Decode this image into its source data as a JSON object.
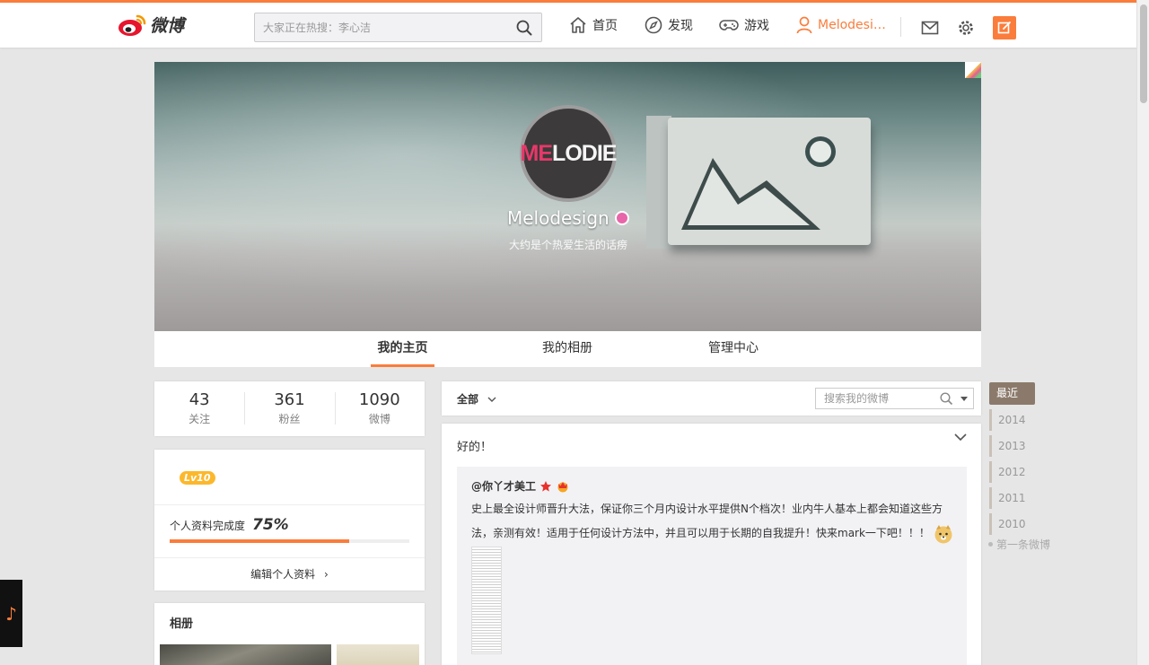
{
  "header": {
    "logo_text": "微博",
    "search_placeholder": "大家正在热搜：李心洁",
    "nav": {
      "home": "首页",
      "discover": "发现",
      "games": "游戏",
      "user": "Melodesi…"
    }
  },
  "cover": {
    "avatar_text_accent": "ME",
    "avatar_text_rest": "LODIE",
    "username": "Melodesign",
    "bio": "大约是个热爱生活的话痨"
  },
  "profile_tabs": [
    "我的主页",
    "我的相册",
    "管理中心"
  ],
  "stats": [
    {
      "num": "43",
      "label": "关注"
    },
    {
      "num": "361",
      "label": "粉丝"
    },
    {
      "num": "1090",
      "label": "微博"
    }
  ],
  "profile_card": {
    "level": "Lv10",
    "completion_label": "个人资料完成度",
    "completion_value": "75%",
    "completion_fraction": 0.75,
    "edit_label": "编辑个人资料"
  },
  "album": {
    "title": "相册"
  },
  "feed": {
    "filter_label": "全部",
    "search_placeholder": "搜索我的微博",
    "post": {
      "text": "好的！",
      "repost_user": "@你丫才美工",
      "repost_line1": "史上最全设计师晋升大法，保证你三个月内设计水平提供N个档次！业内牛人基本上都会知道这些方",
      "repost_line2": "法，亲测有效！适用于任何设计方法中，并且可以用于长期的自我提升！快来mark一下吧！！！"
    }
  },
  "timeline": {
    "recent": "最近",
    "years": [
      "2014",
      "2013",
      "2012",
      "2011",
      "2010"
    ],
    "first": "第一条微博"
  },
  "colors": {
    "accent": "#fa7d3c",
    "timeline_active": "#8b7a6b"
  }
}
